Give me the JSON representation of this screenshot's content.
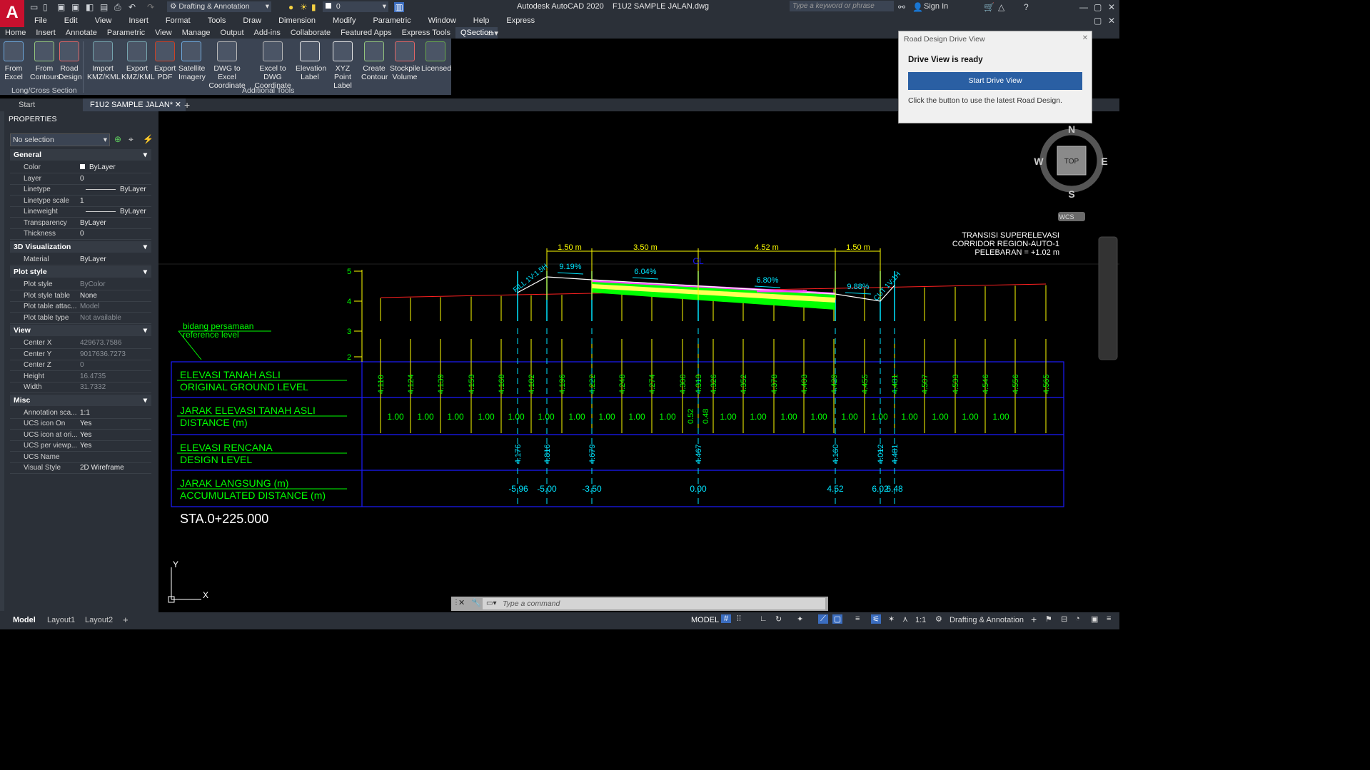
{
  "app": {
    "title": "Autodesk AutoCAD 2020",
    "file": "F1U2 SAMPLE JALAN.dwg",
    "workspace": "Drafting & Annotation",
    "layer_value": "0",
    "search_placeholder": "Type a keyword or phrase",
    "sign_in": "Sign In"
  },
  "menu": [
    "File",
    "Edit",
    "View",
    "Insert",
    "Format",
    "Tools",
    "Draw",
    "Dimension",
    "Modify",
    "Parametric",
    "Window",
    "Help",
    "Express"
  ],
  "ribbon_tabs": [
    "Home",
    "Insert",
    "Annotate",
    "Parametric",
    "View",
    "Manage",
    "Output",
    "Add-ins",
    "Collaborate",
    "Featured Apps",
    "Express Tools",
    "QSection"
  ],
  "ribbon_buttons": [
    {
      "l1": "From",
      "l2": "Excel"
    },
    {
      "l1": "From",
      "l2": "Contours"
    },
    {
      "l1": "Road",
      "l2": "Design"
    },
    {
      "l1": "Import",
      "l2": "KMZ/KML"
    },
    {
      "l1": "Export",
      "l2": "KMZ/KML"
    },
    {
      "l1": "Export",
      "l2": "PDF"
    },
    {
      "l1": "Satellite",
      "l2": "Imagery"
    },
    {
      "l1": "DWG to Excel",
      "l2": "Coordinate"
    },
    {
      "l1": "Excel to DWG",
      "l2": "Coordinate"
    },
    {
      "l1": "Elevation",
      "l2": "Label"
    },
    {
      "l1": "XYZ Point",
      "l2": "Label"
    },
    {
      "l1": "Create",
      "l2": "Contour"
    },
    {
      "l1": "Stockpile",
      "l2": "Volume"
    },
    {
      "l1": "Licensed",
      "l2": ""
    }
  ],
  "ribbon_panels": {
    "p1": "Long/Cross Section",
    "p2": "Additional Tools"
  },
  "doc_tabs": {
    "start": "Start",
    "active": "F1U2 SAMPLE JALAN*"
  },
  "properties": {
    "title": "PROPERTIES",
    "selection": "No selection",
    "general": {
      "title": "General",
      "color": "ByLayer",
      "layer": "0",
      "linetype": "ByLayer",
      "linetype_scale": "1",
      "lineweight": "ByLayer",
      "transparency": "ByLayer",
      "thickness": "0"
    },
    "viz": {
      "title": "3D Visualization",
      "material": "ByLayer"
    },
    "plot": {
      "title": "Plot style",
      "plot_style": "ByColor",
      "plot_style_table": "None",
      "plot_table_attach": "Model",
      "plot_table_type": "Not available"
    },
    "view": {
      "title": "View",
      "center_x": "429673.7586",
      "center_y": "9017636.7273",
      "center_z": "0",
      "height": "16.4735",
      "width": "31.7332"
    },
    "misc": {
      "title": "Misc",
      "annotation_scale": "1:1",
      "ucs_on": "Yes",
      "ucs_origin": "Yes",
      "ucs_viewport": "Yes",
      "ucs_name": "",
      "visual_style": "2D Wireframe"
    },
    "labels": {
      "color": "Color",
      "layer": "Layer",
      "linetype": "Linetype",
      "linetype_scale": "Linetype scale",
      "lineweight": "Lineweight",
      "transparency": "Transparency",
      "thickness": "Thickness",
      "material": "Material",
      "plot_style": "Plot style",
      "plot_style_table": "Plot style table",
      "plot_table_attach": "Plot table attac...",
      "plot_table_type": "Plot table type",
      "center_x": "Center X",
      "center_y": "Center Y",
      "center_z": "Center Z",
      "height": "Height",
      "width": "Width",
      "annotation_scale": "Annotation sca...",
      "ucs_on": "UCS icon On",
      "ucs_origin": "UCS icon at ori...",
      "ucs_viewport": "UCS per viewp...",
      "ucs_name": "UCS Name",
      "visual_style": "Visual Style"
    }
  },
  "drawing": {
    "notes": [
      "TRANSISI SUPERELEVASI",
      "CORRIDOR REGION-AUTO-1",
      "PELEBARAN = +1.02 m"
    ],
    "ref_note": [
      "bidang persamaan",
      "reference level"
    ],
    "dims": [
      "1.50 m",
      "3.50 m",
      "4.52 m",
      "1.50 m"
    ],
    "cl": "CL",
    "slopes": [
      "9.19%",
      "6.04%",
      "6.80%",
      "9.88%"
    ],
    "fill": "FILL 1V:1.5H",
    "cut": "CUT 1V:1H",
    "yaxis": [
      "5",
      "4",
      "3",
      "2"
    ],
    "rows": [
      {
        "l1": "ELEVASI TANAH ASLI",
        "l2": "ORIGINAL GROUND LEVEL"
      },
      {
        "l1": "JARAK ELEVASI TANAH ASLI",
        "l2": "DISTANCE (m)"
      },
      {
        "l1": "ELEVASI RENCANA",
        "l2": "DESIGN LEVEL"
      },
      {
        "l1": "JARAK LANGSUNG (m)",
        "l2": "ACCUMULATED DISTANCE (m)"
      }
    ],
    "ground_levels": [
      "4.110",
      "4.124",
      "4.139",
      "4.153",
      "4.168",
      "4.182",
      "4.196",
      "4.222",
      "4.248",
      "4.274",
      "4.300",
      "4.313",
      "4.326",
      "4.352",
      "4.378",
      "4.403",
      "4.429",
      "4.455",
      "4.481",
      "4.507",
      "4.533",
      "4.546",
      "4.556",
      "4.565"
    ],
    "distances": [
      "1.00",
      "1.00",
      "1.00",
      "1.00",
      "1.00",
      "1.00",
      "1.00",
      "1.00",
      "1.00",
      "1.00",
      "0.52",
      "0.48",
      "1.00",
      "1.00",
      "1.00",
      "1.00",
      "1.00",
      "1.00",
      "1.00",
      "1.00",
      "1.00",
      "1.00"
    ],
    "design_levels": [
      "4.176",
      "4.816",
      "4.679",
      "4.467",
      "4.160",
      "4.012",
      "4.481"
    ],
    "accum": [
      "-5.96",
      "-5.00",
      "-3.50",
      "0.00",
      "4.52",
      "6.02",
      "6.48"
    ],
    "station": "STA.0+225.000"
  },
  "viewcube": {
    "n": "N",
    "s": "S",
    "e": "E",
    "w": "W",
    "top": "TOP",
    "wcs": "WCS"
  },
  "ucs": {
    "x": "X",
    "y": "Y"
  },
  "drive": {
    "header": "Road Design Drive View",
    "title": "Drive View is ready",
    "button": "Start Drive View",
    "sub": "Click the button to use the latest Road Design."
  },
  "command": {
    "placeholder": "Type a command"
  },
  "status": {
    "tabs": [
      "Model",
      "Layout1",
      "Layout2"
    ],
    "model": "MODEL",
    "scale": "1:1",
    "workspace": "Drafting & Annotation"
  }
}
